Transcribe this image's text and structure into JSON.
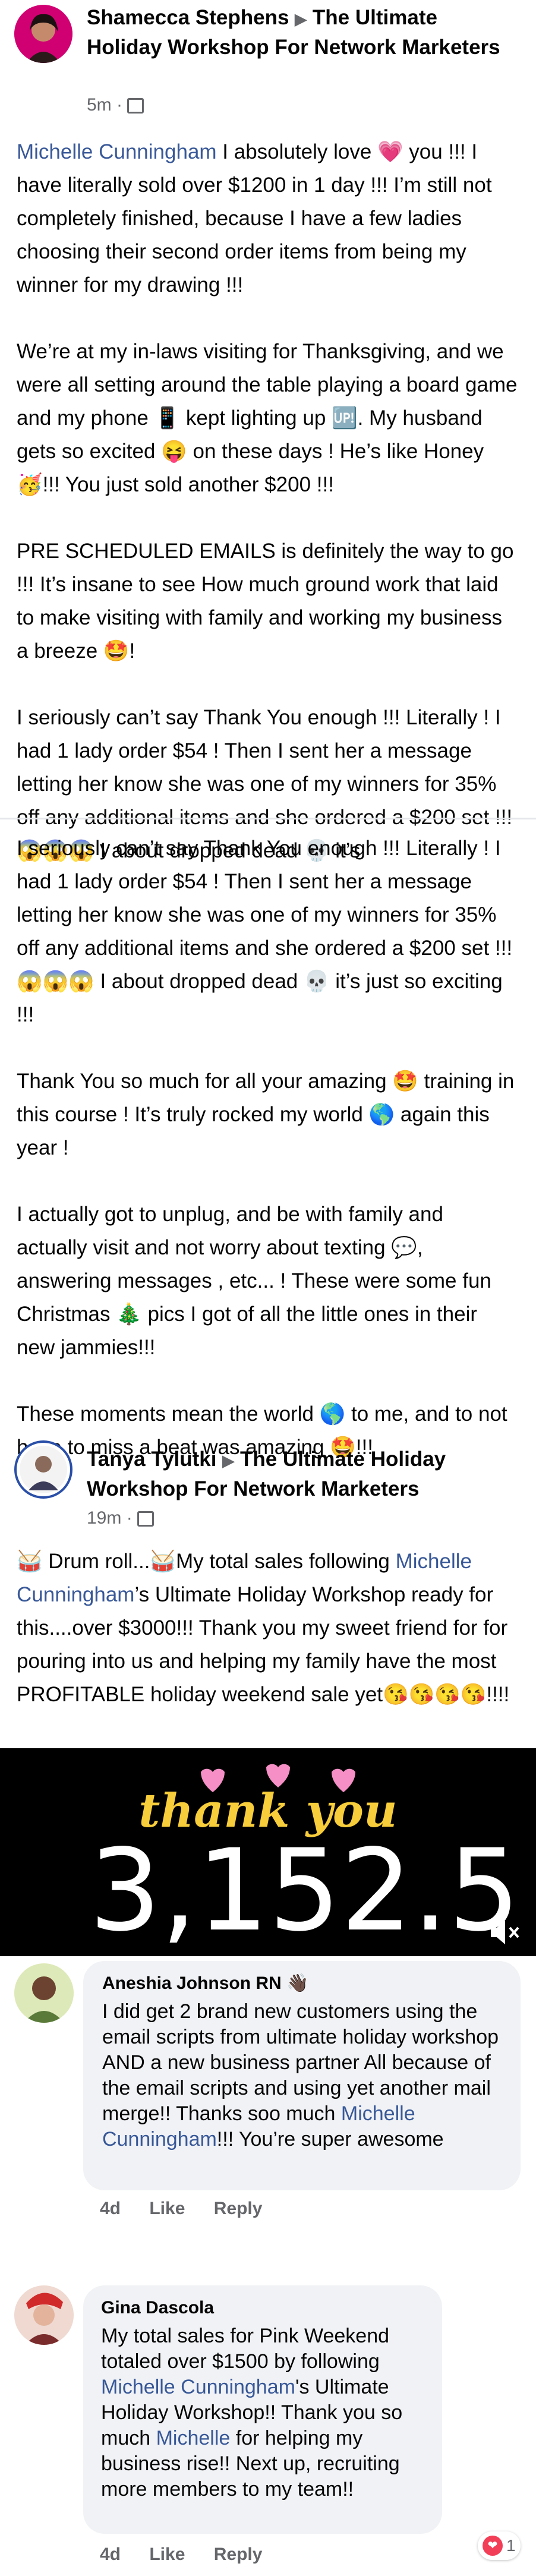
{
  "post1": {
    "author": "Shamecca Stephens",
    "group": "The Ultimate Holiday Workshop For Network Marketers",
    "time": "5m",
    "mention": "Michelle Cunningham",
    "p1": " I absolutely love 💗 you !!! I have literally sold over $1200 in 1 day !!! I’m still not completely finished, because I have a few ladies choosing their second order items from being my winner for my drawing !!!",
    "p2": "We’re at my in-laws visiting for Thanksgiving, and we were all setting around the table playing a board game and my phone 📱 kept lighting up 🆙. My husband gets so excited 😝 on these days ! He’s like Honey 🥳!!! You just sold another $200 !!!",
    "p3": "PRE SCHEDULED EMAILS is definitely the way to go !!! It’s insane to see How much ground work that laid to make visiting with family and working my business a breeze 🤩!",
    "p4": "I seriously can’t say Thank You enough !!! Literally ! I had 1 lady order $54 ! Then I sent her a message letting her know she was one of my winners for 35% off any additional items and she ordered a $200 set !!! 😱😱😱 I about dropped dead 💀 it’s",
    "p5": "I seriously can’t say Thank You enough !!! Literally ! I had 1 lady order $54 ! Then I sent her a message letting her know she was one of my winners for 35% off any additional items and she ordered a $200 set !!! 😱😱😱 I about dropped dead 💀 it’s just so exciting !!!",
    "p6": "Thank You so much for all your amazing 🤩 training in this course ! It’s truly rocked my world 🌎 again this year !",
    "p7": "I actually got to unplug, and be with family and actually visit and not worry about texting 💬, answering messages , etc... ! These were some fun Christmas 🎄 pics I got of all the little ones in their new jammies!!!",
    "p8": "These moments mean the world 🌎 to me, and to not have to miss a beat was amazing 🤩!!!"
  },
  "post2": {
    "author": "Tanya Tylutki",
    "group": "The Ultimate Holiday Workshop For Network Marketers",
    "time": "19m",
    "text_a": "🥁 Drum roll...🥁My total sales following ",
    "mention": "Michelle Cunningham",
    "text_b": "’s Ultimate Holiday Workshop ready for this....over $3000!!! Thank you my sweet friend for for pouring into us and helping my family have the most PROFITABLE holiday weekend sale yet😘😘😘😘!!!!"
  },
  "video": {
    "caption": "thank you",
    "number": "3,152.5",
    "colors": {
      "bg": "#000000",
      "text": "#ffffff",
      "accent": "#f7cd3b",
      "hearts": "#f58fc6"
    },
    "mute_icon": "speaker-muted-icon"
  },
  "comments": [
    {
      "author": "Aneshia Johnson RN 👋🏿",
      "text_a": "I did get 2 brand new customers using the email scripts from ultimate holiday workshop AND a new business partner All because of the email scripts and using yet another mail merge!! Thanks soo much ",
      "mention": "Michelle Cunningham",
      "text_b": "!!! You’re super awesome",
      "time": "4d",
      "like": "Like",
      "reply": "Reply"
    },
    {
      "author": "Gina Dascola",
      "text_a": "My total sales for Pink Weekend totaled over $1500 by following ",
      "mention": "Michelle Cunningham",
      "text_b": "'s Ultimate Holiday Workshop!! Thank you so much ",
      "mention2": "Michelle",
      "text_c": " for helping my business rise!!  Next up, recruiting more members to my team!!",
      "time": "4d",
      "like": "Like",
      "reply": "Reply",
      "reaction_count": "1"
    }
  ],
  "meta_separator": "·",
  "colors": {
    "link": "#385898",
    "meta": "#65676b",
    "bubble": "#f0f2f5"
  }
}
